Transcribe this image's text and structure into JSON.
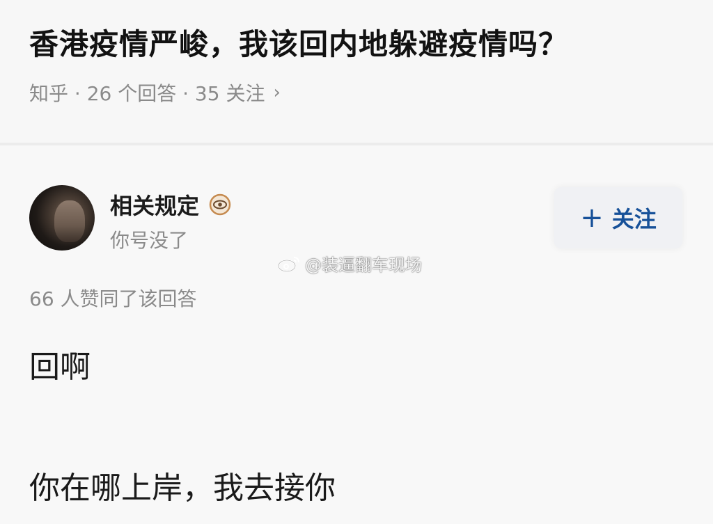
{
  "question": {
    "title": "香港疫情严峻，我该回内地躲避疫情吗？",
    "meta": "知乎 · 26 个回答 · 35 关注",
    "chevron": "›"
  },
  "answer": {
    "author": {
      "name": "相关规定",
      "bio": "你号没了"
    },
    "follow": {
      "plus": "+",
      "label": "关注",
      "color": "#175199"
    },
    "watermark": "@装逼翻车现场",
    "votes": "66 人赞同了该回答",
    "lines": [
      "回啊",
      "你在哪上岸，我去接你"
    ]
  },
  "colors": {
    "background": "#f8f8f8",
    "secondary_text": "#8a8a8a",
    "primary_text": "#1a1a1a"
  }
}
